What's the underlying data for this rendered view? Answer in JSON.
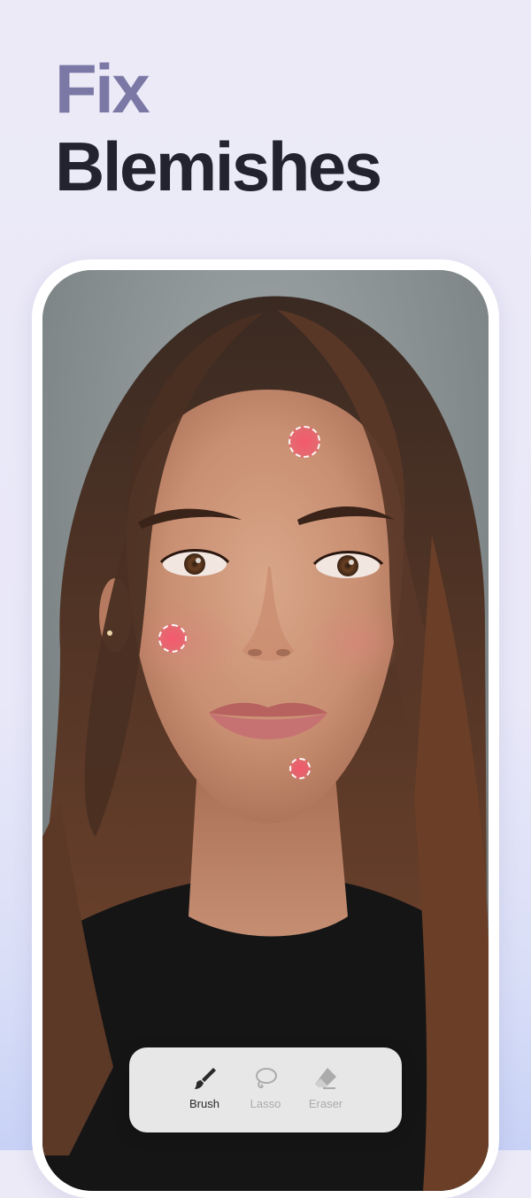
{
  "headline": {
    "line1": "Fix",
    "line2": "Blemishes"
  },
  "colors": {
    "headline_accent": "#7B78A6",
    "headline_dark": "#23222F",
    "marker_fill": "#F6566E",
    "active_tool": "#2A2A2A",
    "inactive_tool": "#ABABAB"
  },
  "photo": {
    "subject": "portrait of a woman with long brown hair",
    "markers": [
      {
        "name": "forehead"
      },
      {
        "name": "left-cheek"
      },
      {
        "name": "chin"
      }
    ]
  },
  "toolbar": {
    "tools": [
      {
        "label": "Brush",
        "icon": "brush-icon",
        "active": true
      },
      {
        "label": "Lasso",
        "icon": "lasso-icon",
        "active": false
      },
      {
        "label": "Eraser",
        "icon": "eraser-icon",
        "active": false
      }
    ]
  }
}
